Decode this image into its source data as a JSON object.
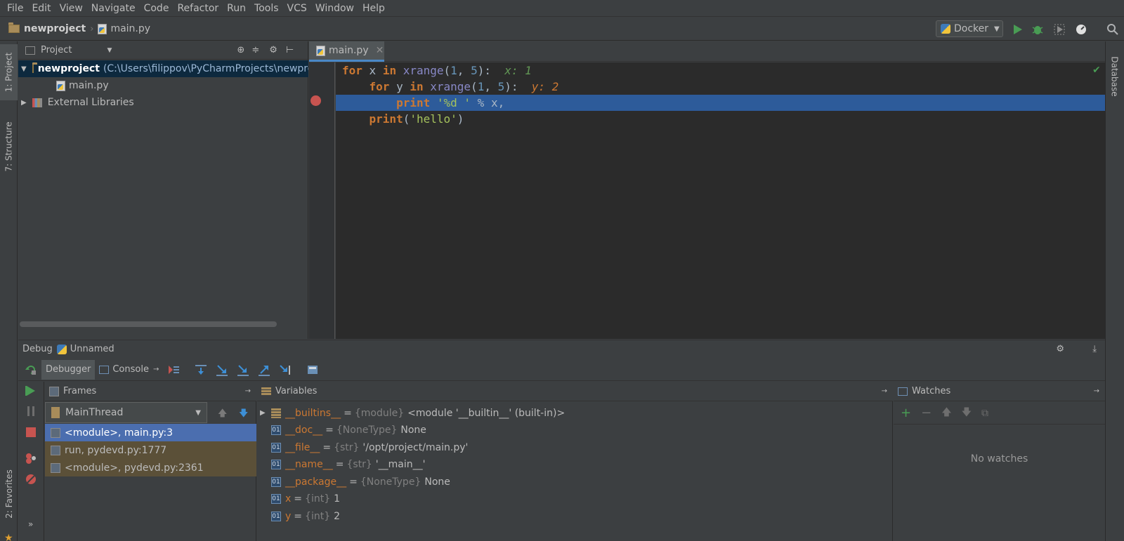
{
  "menu": [
    "File",
    "Edit",
    "View",
    "Navigate",
    "Code",
    "Refactor",
    "Run",
    "Tools",
    "VCS",
    "Window",
    "Help"
  ],
  "navbar": {
    "project": "newproject",
    "file": "main.py"
  },
  "run_config": {
    "label": "Docker"
  },
  "left_stripe": {
    "project_tab": "1: Project",
    "structure_tab": "7: Structure",
    "favorites_tab": "2: Favorites"
  },
  "right_stripe": {
    "database_tab": "Database"
  },
  "project_panel": {
    "header": "Project",
    "root_name": "newproject",
    "root_path": "(C:\\Users\\filippov\\PyCharmProjects\\newpro",
    "file": "main.py",
    "external": "External Libraries"
  },
  "editor": {
    "tab": "main.py",
    "lines": [
      {
        "indent": "",
        "parts": [
          [
            "kw",
            "for"
          ],
          [
            "plain",
            " x "
          ],
          [
            "kw",
            "in"
          ],
          [
            "plain",
            " "
          ],
          [
            "fn",
            "xrange"
          ],
          [
            "plain",
            "("
          ],
          [
            "num",
            "1"
          ],
          [
            "plain",
            ", "
          ],
          [
            "num",
            "5"
          ],
          [
            "plain",
            "):"
          ]
        ],
        "inline": "x: 1",
        "inline_class": "inline-val"
      },
      {
        "indent": "    ",
        "parts": [
          [
            "kw",
            "for"
          ],
          [
            "plain",
            " y "
          ],
          [
            "kw",
            "in"
          ],
          [
            "plain",
            " "
          ],
          [
            "fn",
            "xrange"
          ],
          [
            "plain",
            "("
          ],
          [
            "num",
            "1"
          ],
          [
            "plain",
            ", "
          ],
          [
            "num",
            "5"
          ],
          [
            "plain",
            "):"
          ]
        ],
        "inline": "y: 2",
        "inline_class": "inline-val2"
      },
      {
        "indent": "        ",
        "parts": [
          [
            "kw",
            "print"
          ],
          [
            "plain",
            " "
          ],
          [
            "str",
            "'%d '"
          ],
          [
            "plain",
            " % x,"
          ]
        ],
        "inline": "",
        "inline_class": ""
      },
      {
        "indent": "    ",
        "parts": [
          [
            "kw",
            "print"
          ],
          [
            "plain",
            "("
          ],
          [
            "str",
            "'hello'"
          ],
          [
            "plain",
            ")"
          ]
        ],
        "inline": "",
        "inline_class": ""
      }
    ]
  },
  "debug": {
    "title": "Debug",
    "config": "Unnamed",
    "tab_debugger": "Debugger",
    "tab_console": "Console",
    "frames_header": "Frames",
    "thread": "MainThread",
    "frames": [
      "<module>, main.py:3",
      "run, pydevd.py:1777",
      "<module>, pydevd.py:2361"
    ],
    "variables_header": "Variables",
    "variables": [
      {
        "name": "__builtins__",
        "type": "{module}",
        "value": "<module '__builtin__' (built-in)>",
        "expandable": true
      },
      {
        "name": "__doc__",
        "type": "{NoneType}",
        "value": "None",
        "expandable": false
      },
      {
        "name": "__file__",
        "type": "{str}",
        "value": "'/opt/project/main.py'",
        "expandable": false
      },
      {
        "name": "__name__",
        "type": "{str}",
        "value": "'__main__'",
        "expandable": false
      },
      {
        "name": "__package__",
        "type": "{NoneType}",
        "value": "None",
        "expandable": false
      },
      {
        "name": "x",
        "type": "{int}",
        "value": "1",
        "expandable": false
      },
      {
        "name": "y",
        "type": "{int}",
        "value": "2",
        "expandable": false
      }
    ],
    "watches_header": "Watches",
    "no_watches": "No watches"
  }
}
